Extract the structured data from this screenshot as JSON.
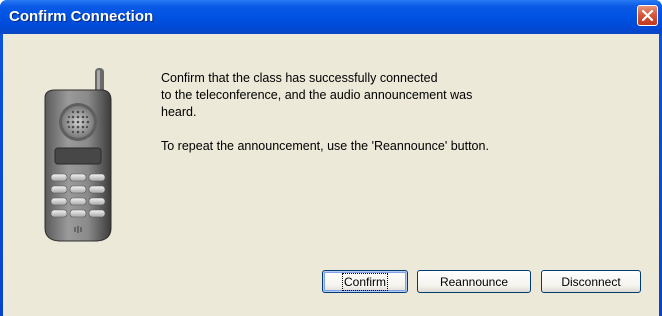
{
  "window": {
    "title": "Confirm Connection"
  },
  "message": {
    "line1": "Confirm that the class has successfully connected",
    "line2": "to the teleconference, and the audio announcement was",
    "line3": "heard.",
    "line4": "To repeat the announcement, use the 'Reannounce' button."
  },
  "buttons": {
    "confirm": "Confirm",
    "reannounce": "Reannounce",
    "disconnect": "Disconnect"
  },
  "icons": {
    "close": "close-icon",
    "phone": "phone-icon"
  },
  "colors": {
    "titlebar": "#0052e3",
    "close": "#d4523a",
    "dialog_bg": "#ece9d8",
    "button_border": "#003c74"
  }
}
